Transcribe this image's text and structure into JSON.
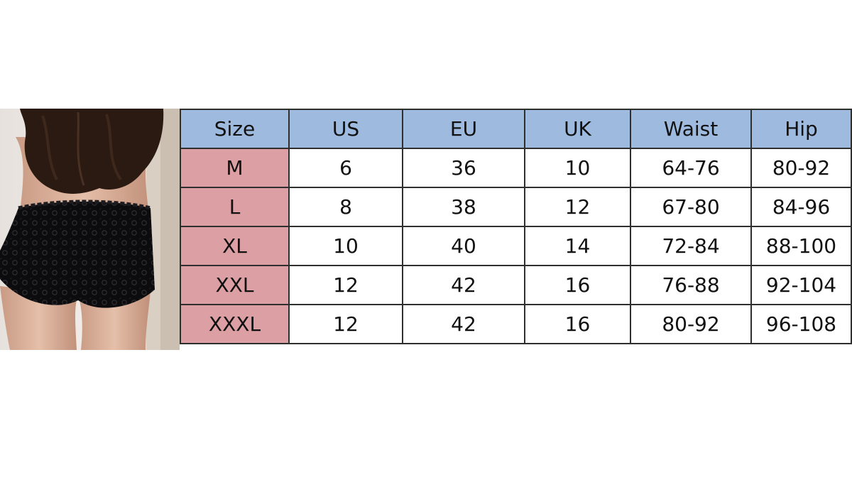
{
  "size_chart": {
    "columns": [
      "Size",
      "US",
      "EU",
      "UK",
      "Waist",
      "Hip"
    ],
    "rows": [
      [
        "M",
        "6",
        "36",
        "10",
        "64-76",
        "80-92"
      ],
      [
        "L",
        "8",
        "38",
        "12",
        "67-80",
        "84-96"
      ],
      [
        "XL",
        "10",
        "40",
        "14",
        "72-84",
        "88-100"
      ],
      [
        "XXL",
        "12",
        "42",
        "16",
        "76-88",
        "92-104"
      ],
      [
        "XXXL",
        "12",
        "42",
        "16",
        "80-92",
        "96-108"
      ]
    ],
    "colors": {
      "header_bg": "#9ebbdf",
      "size_column_bg": "#dc9fa3",
      "border": "#2f2f2f"
    }
  },
  "product_photo": {
    "subject": "black lace panties worn, rear view"
  }
}
